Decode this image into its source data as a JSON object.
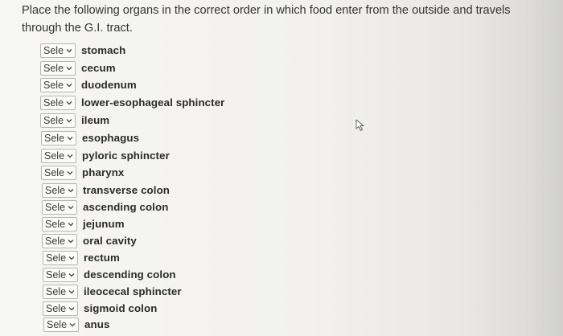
{
  "question": "Place the following organs in the correct order in which food enter from the outside and travels through the G.I. tract.",
  "select_placeholder": "Sele",
  "items": [
    "stomach",
    "cecum",
    "duodenum",
    "lower-esophageal sphincter",
    "ileum",
    "esophagus",
    "pyloric sphincter",
    "pharynx",
    "transverse colon",
    "ascending colon",
    "jejunum",
    "oral cavity",
    "rectum",
    "descending colon",
    "ileocecal sphincter",
    "sigmoid colon",
    "anus"
  ],
  "icons": {
    "dropdown": "chevron-down-icon",
    "cursor": "mouse-pointer-icon"
  },
  "colors": {
    "background": "#f2f1ef",
    "text": "#333333",
    "select_border": "#b5b5b3"
  }
}
